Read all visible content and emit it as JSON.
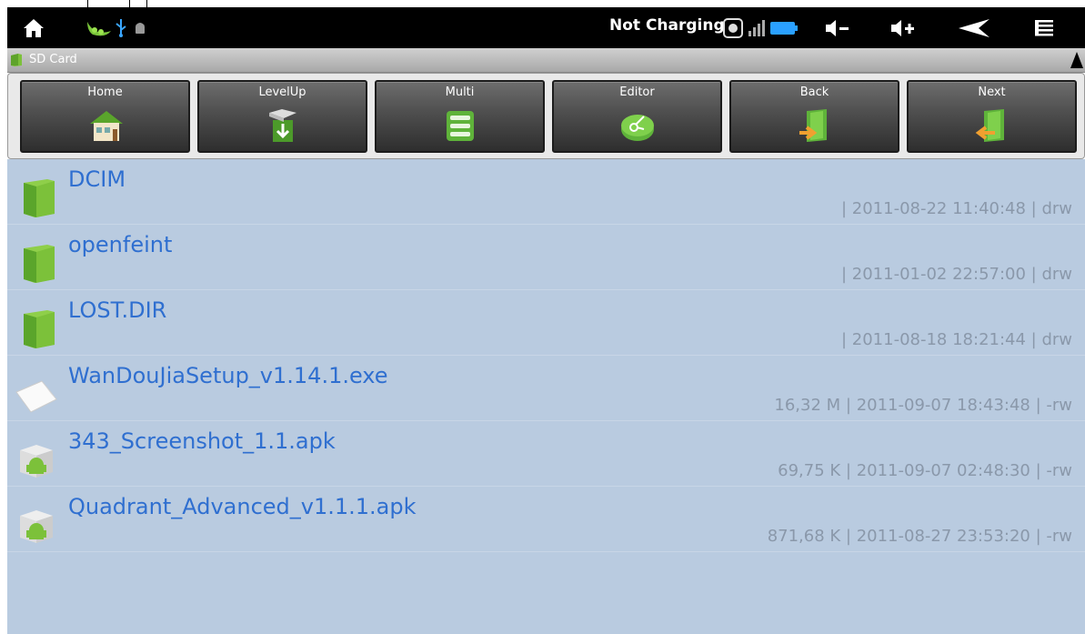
{
  "statusbar": {
    "charging_text": "Not Charging",
    "icons": [
      "home-icon",
      "pea-app-icon",
      "usb-icon",
      "android-debug-icon",
      "sync-icon",
      "signal-icon",
      "battery-icon",
      "volume-down-icon",
      "volume-up-icon",
      "back-arrow-icon",
      "menu-icon"
    ]
  },
  "pathbar": {
    "path": "SD Card"
  },
  "toolbar": {
    "buttons": [
      {
        "label": "Home",
        "icon": "house-icon"
      },
      {
        "label": "LevelUp",
        "icon": "box-up-icon"
      },
      {
        "label": "Multi",
        "icon": "stack-icon"
      },
      {
        "label": "Editor",
        "icon": "scissors-icon"
      },
      {
        "label": "Back",
        "icon": "door-back-icon"
      },
      {
        "label": "Next",
        "icon": "door-next-icon"
      }
    ]
  },
  "files": [
    {
      "name": "DCIM",
      "meta": "| 2011-08-22 11:40:48 | drw",
      "type": "folder"
    },
    {
      "name": "openfeint",
      "meta": "| 2011-01-02 22:57:00 | drw",
      "type": "folder"
    },
    {
      "name": "LOST.DIR",
      "meta": "| 2011-08-18 18:21:44 | drw",
      "type": "folder"
    },
    {
      "name": "WanDouJiaSetup_v1.14.1.exe",
      "meta": "16,32 M | 2011-09-07 18:43:48 | -rw",
      "type": "file"
    },
    {
      "name": "343_Screenshot_1.1.apk",
      "meta": "69,75 K | 2011-09-07 02:48:30 | -rw",
      "type": "apk"
    },
    {
      "name": "Quadrant_Advanced_v1.1.1.apk",
      "meta": "871,68 K | 2011-08-27 23:53:20 | -rw",
      "type": "apk"
    }
  ],
  "colors": {
    "list_bg": "#b9cbe0",
    "file_name": "#2f6fd0",
    "file_meta": "#8a98aa",
    "statusbar_bg": "#000000"
  }
}
